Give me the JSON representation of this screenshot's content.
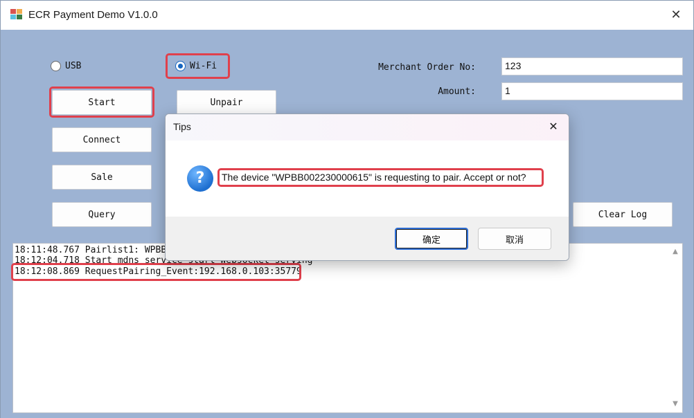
{
  "window": {
    "title": "ECR Payment Demo V1.0.0",
    "close_glyph": "✕"
  },
  "connection": {
    "usb_label": "USB",
    "wifi_label": "Wi-Fi",
    "selected": "Wi-Fi"
  },
  "buttons": {
    "start": "Start",
    "unpair": "Unpair",
    "connect": "Connect",
    "sale": "Sale",
    "query": "Query",
    "clear_log": "Clear Log"
  },
  "form": {
    "merchant_order_label": "Merchant Order No:",
    "merchant_order_value": "123",
    "amount_label": "Amount:",
    "amount_value": "1"
  },
  "log": {
    "lines": [
      "18:11:48.767 Pairlist1: WPBBO",
      "18:12:04.718 Start mdns service  start Websocket serving",
      "18:12:08.869 RequestPairing_Event:192.168.0.103:35779"
    ]
  },
  "dialog": {
    "title": "Tips",
    "close_glyph": "✕",
    "icon": "question-icon",
    "message": "The device \"WPBB002230000615\" is requesting to pair. Accept or not?",
    "ok_label": "确定",
    "cancel_label": "取消"
  },
  "colors": {
    "highlight": "#e0404c",
    "background": "#9db3d3",
    "radio_selected": "#1565c0"
  }
}
